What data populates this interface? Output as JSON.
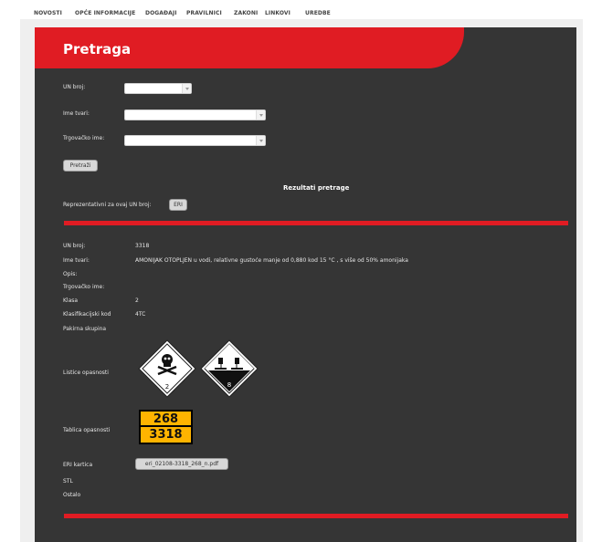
{
  "nav": [
    "NOVOSTI",
    "OPĆE INFORMACIJE",
    "DOGAĐAJI",
    "PRAVILNICI",
    "ZAKONI",
    "LINKOVI",
    "UREDBE"
  ],
  "header": {
    "title": "Pretraga"
  },
  "search": {
    "un_label": "UN broj:",
    "name_label": "Ime tvari:",
    "trade_label": "Trgovačko ime:",
    "search_button": "Pretraži"
  },
  "results": {
    "title": "Rezultati pretrage",
    "representative_label": "Reprezentativni za ovaj UN broj:",
    "eri_button": "ERI"
  },
  "detail": {
    "un_label": "UN broj:",
    "un_value": "3318",
    "name_label": "Ime tvari:",
    "name_value": "AMONIJAK OTOPLJEN u vodi, relativne gustoće manje od 0,880 kod 15 °C , s više od 50% amonijaka",
    "note_label": "Opis:",
    "trade_label": "Trgovačko ime:",
    "class_label": "Klasa",
    "class_value": "2",
    "code_label": "Klasifikacijski kod",
    "code_value": "4TC",
    "pack_label": "Pakirna skupina",
    "labels_label": "Listice opasnosti",
    "hazard_labels": [
      {
        "icon": "skull-crossbones-icon",
        "number": "2"
      },
      {
        "icon": "corrosive-icon",
        "number": "8"
      }
    ],
    "plate_label": "Tablica opasnosti",
    "plate_top": "268",
    "plate_bottom": "3318",
    "eri_label": "ERI kartica",
    "eri_file": "eri_02108-3318_268_n.pdf",
    "stl_label": "STL",
    "other_label": "Ostalo"
  },
  "colors": {
    "accent": "#e01c23",
    "panel": "#353535",
    "plate": "#ffb400"
  }
}
